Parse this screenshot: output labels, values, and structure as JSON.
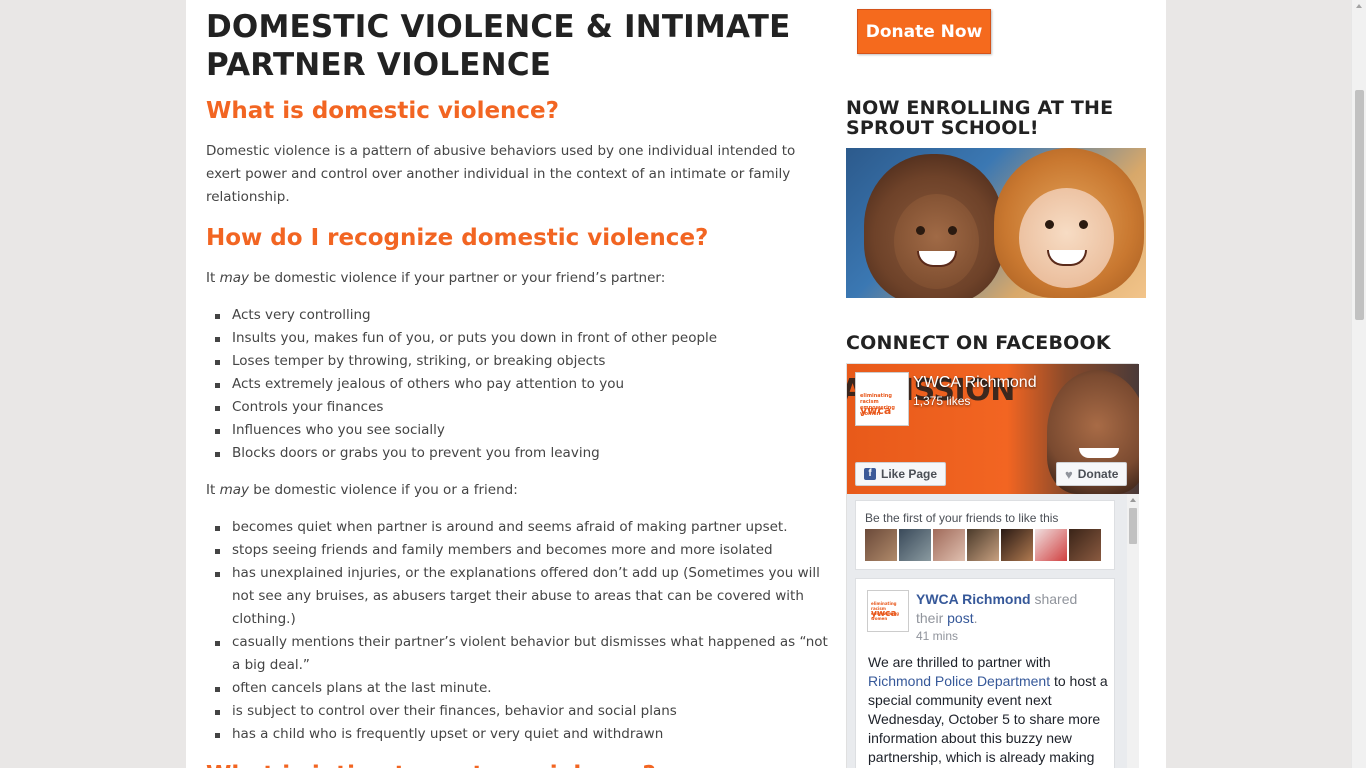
{
  "main": {
    "title": "DOMESTIC VIOLENCE & INTIMATE PARTNER VIOLENCE",
    "section1_heading": "What is domestic violence?",
    "section1_text": "Domestic violence is a pattern of abusive behaviors used by one individual intended to exert power and control over another individual in the context of an intimate or family relationship.",
    "section2_heading": "How do I recognize domestic violence?",
    "intro1_pre": "It ",
    "intro1_em": "may",
    "intro1_post": " be domestic violence if your partner or your friend’s partner:",
    "list1": [
      "Acts very controlling",
      "Insults you, makes fun of you, or puts you down in front of other people",
      "Loses temper by throwing, striking, or breaking objects",
      "Acts extremely jealous of others who pay attention to you",
      "Controls your finances",
      "Influences who you see socially",
      "Blocks doors or grabs you to prevent you from leaving"
    ],
    "intro2_pre": "It ",
    "intro2_em": "may",
    "intro2_post": " be domestic violence if you or a friend:",
    "list2": [
      "becomes quiet when partner is around and seems afraid of making partner upset.",
      "stops seeing friends and family members and becomes more and more isolated",
      "has unexplained injuries, or the explanations offered don’t add up (Sometimes you will not see any bruises, as abusers target their abuse to areas that can be covered with clothing.)",
      "casually mentions their partner’s violent behavior but dismisses what happened as “not a big deal.”",
      "often cancels plans at the last minute.",
      "is subject to control over their finances, behavior and social plans",
      "has a child who is frequently upset or very quiet and withdrawn"
    ],
    "section3_heading": "What is intimate partner violence?"
  },
  "sidebar": {
    "donate_label": "Donate Now",
    "enroll_heading": "NOW ENROLLING AT THE SPROUT SCHOOL!",
    "facebook_heading": "CONNECT ON FACEBOOK"
  },
  "facebook": {
    "cover_text": "A MISSION",
    "logo_small_text": "eliminating racism empowering women",
    "logo_text": "ywca",
    "page_name": "YWCA Richmond",
    "likes": "1,375 likes",
    "like_button": "Like Page",
    "donate_button": "Donate",
    "friends_text": "Be the first of your friends to like this",
    "post": {
      "author": "YWCA Richmond",
      "shared": " shared their ",
      "post_link": "post",
      "period": ".",
      "time": "41 mins",
      "body_pre": "We are thrilled to partner with ",
      "body_link": "Richmond Police Department",
      "body_post": " to host a special community event next Wednesday, October 5 to share more information about this buzzy new partnership, which is already making"
    }
  },
  "colors": {
    "accent": "#f26522",
    "fb_blue": "#365899",
    "donate_bg": "#f56a1d"
  }
}
